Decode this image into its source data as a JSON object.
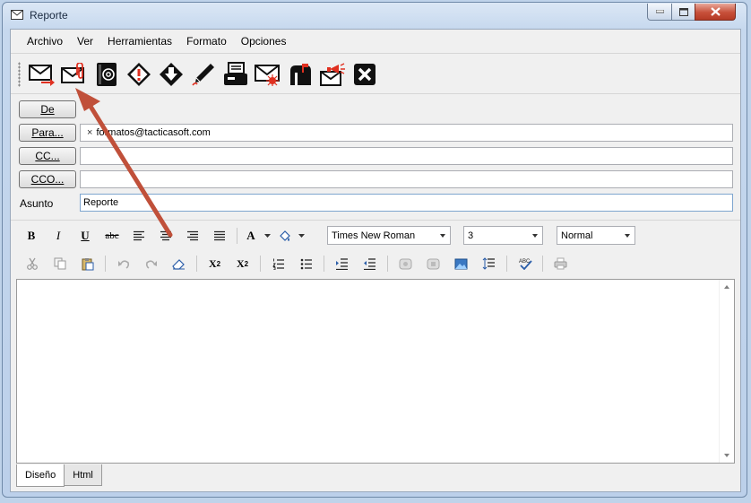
{
  "window": {
    "title": "Reporte"
  },
  "menu": [
    "Archivo",
    "Ver",
    "Herramientas",
    "Formato",
    "Opciones"
  ],
  "toolbar_icons": [
    "send-mail-icon",
    "attach-mail-icon",
    "address-book-icon",
    "priority-high-icon",
    "priority-low-icon",
    "signature-pen-icon",
    "print-fax-icon",
    "flagged-mail-icon",
    "mailbox-icon",
    "announce-mail-icon",
    "close-x-icon"
  ],
  "header": {
    "de_label": "De",
    "para_label": "Para...",
    "cc_label": "CC...",
    "cco_label": "CCO...",
    "asunto_label": "Asunto",
    "para_value": "formatos@tacticasoft.com",
    "chip_remove": "×",
    "cc_value": "",
    "cco_value": "",
    "asunto_value": "Reporte"
  },
  "format": {
    "bold": "B",
    "italic": "I",
    "underline": "U",
    "strike": "abc",
    "font_color": "A",
    "font_name": "Times New Roman",
    "font_size": "3",
    "style": "Normal"
  },
  "edit": {
    "subscript": "X",
    "sub_mark": "2",
    "superscript": "X",
    "sup_mark": "2"
  },
  "tabs": {
    "design": "Diseño",
    "html": "Html"
  },
  "colors": {
    "annotation_arrow": "#c0503a",
    "accent_red": "#e03020"
  }
}
